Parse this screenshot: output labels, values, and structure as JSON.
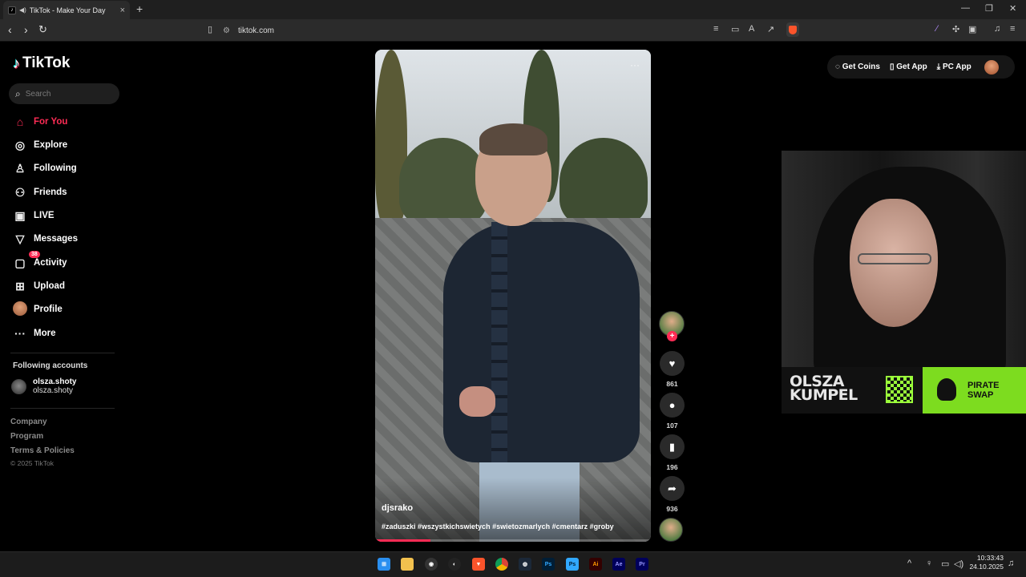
{
  "browser": {
    "tab_title": "TikTok - Make Your Day",
    "url": "tiktok.com"
  },
  "tiktok": {
    "logo": "TikTok",
    "search_placeholder": "Search",
    "nav": [
      {
        "label": "For You",
        "icon": "home-icon"
      },
      {
        "label": "Explore",
        "icon": "compass-icon"
      },
      {
        "label": "Following",
        "icon": "user-check-icon"
      },
      {
        "label": "Friends",
        "icon": "users-icon"
      },
      {
        "label": "LIVE",
        "icon": "live-tv-icon"
      },
      {
        "label": "Messages",
        "icon": "send-icon"
      },
      {
        "label": "Activity",
        "icon": "inbox-icon",
        "badge": "38"
      },
      {
        "label": "Upload",
        "icon": "plus-square-icon"
      },
      {
        "label": "Profile",
        "icon": "avatar"
      },
      {
        "label": "More",
        "icon": "ellipsis-icon"
      }
    ],
    "following_accounts": {
      "title": "Following accounts",
      "accounts": [
        {
          "username": "olsza.shoty",
          "display": "olsza.shoty"
        }
      ]
    },
    "footer": [
      "Company",
      "Program",
      "Terms & Policies"
    ],
    "copyright": "© 2025 TikTok",
    "accent_color": "#fe2c55"
  },
  "video": {
    "author": "djsrako",
    "caption": "#zaduszki #wszystkichswietych #swietozmarlych #cmentarz #groby",
    "progress_fraction": 0.2,
    "likes": "861",
    "comments": "107",
    "saves": "196",
    "shares": "936"
  },
  "topbar": {
    "coins": "Get Coins",
    "app": "Get App",
    "pc_app": "PC App"
  },
  "overlay": {
    "brand_line1": "OLSZA",
    "brand_line2": "KUMPEL",
    "sponsor_line1": "PIRATE",
    "sponsor_line2": "SWAP",
    "sponsor_color": "#7ddc1f"
  },
  "taskbar": {
    "time": "10:33:43",
    "date": "24.10.2025",
    "apps": [
      "windows-start-icon",
      "file-explorer-icon",
      "obs-icon",
      "steam-like-icon",
      "brave-icon",
      "chrome-icon",
      "steam-icon",
      "photoshop-icon",
      "photoshop-alt-icon",
      "illustrator-icon",
      "after-effects-icon",
      "premiere-icon"
    ],
    "app_labels": [
      "Ps",
      "Ps",
      "Ai",
      "Ae",
      "Pr"
    ]
  }
}
